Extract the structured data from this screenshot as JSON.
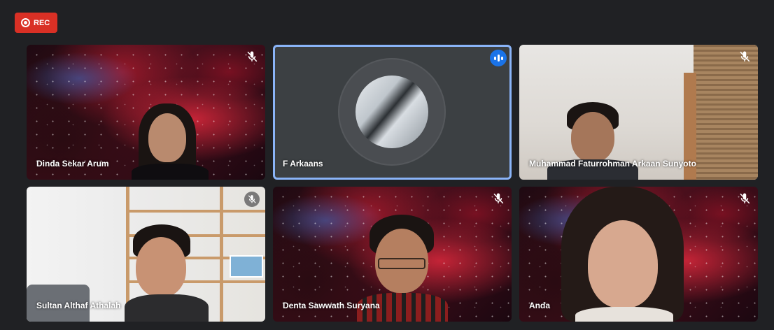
{
  "recording": {
    "label": "REC",
    "color": "#d93025"
  },
  "participants": [
    {
      "name": "Dinda Sekar Arum",
      "muted": true,
      "background": "space"
    },
    {
      "name": "F Arkaans",
      "muted": false,
      "speaking": true,
      "camera": "off"
    },
    {
      "name": "Muhammad Faturrohman Arkaan Sunyoto",
      "muted": true,
      "background": "room"
    },
    {
      "name": "Sultan Althaf Athalah",
      "muted": true,
      "background": "shelf"
    },
    {
      "name": "Denta Sawwath Suryana",
      "muted": true,
      "background": "space"
    },
    {
      "name": "Anda",
      "muted": true,
      "background": "space"
    }
  ],
  "icons": {
    "muted": "mic-off-icon",
    "speaking": "audio-level-icon",
    "recording": "record-icon"
  },
  "colors": {
    "background": "#202124",
    "active_outline": "#8ab4f8",
    "speaking_badge": "#1a73e8"
  }
}
